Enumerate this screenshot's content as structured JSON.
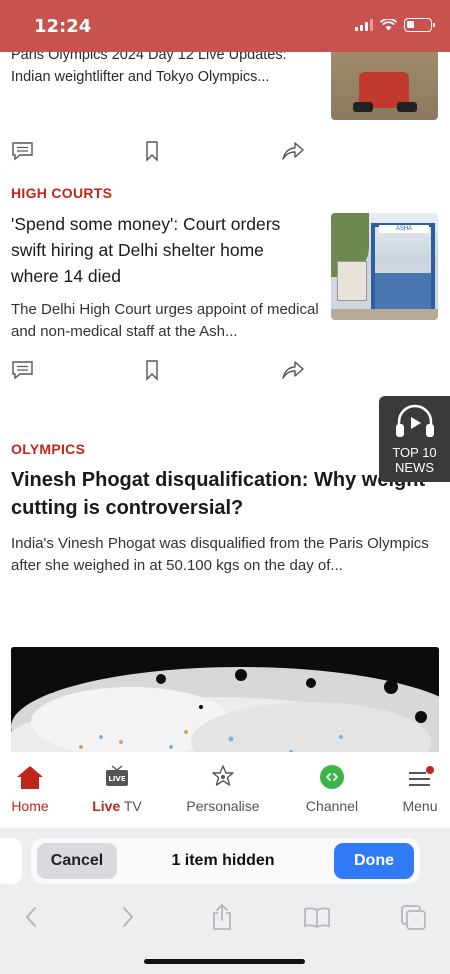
{
  "status": {
    "time": "12:24"
  },
  "articles": [
    {
      "category": "",
      "headline": "Paris Olympics 2024 Day 12 Live Updates: Indian weightlifter and Tokyo Olympics..."
    },
    {
      "category": "HIGH COURTS",
      "headline": "'Spend some money': Court orders swift hiring at Delhi shelter home where 14 died",
      "summary": "The Delhi High Court urges appoint of medical and non-medical staff at the Ash...",
      "thumb_sign": "ASHA"
    },
    {
      "category": "OLYMPICS",
      "headline": "Vinesh Phogat disqualification: Why weight cutting is controversial?",
      "summary": "India's Vinesh Phogat was disqualified from the Paris Olympics after she weighed in at 50.100 kgs on the day of..."
    }
  ],
  "top10": {
    "line1": "TOP 10",
    "line2": "NEWS"
  },
  "tabs": {
    "home": "Home",
    "live_badge": "LIVE",
    "live_red": "Live",
    "live_rest": " TV",
    "personalise": "Personalise",
    "channel": "Channel",
    "menu": "Menu"
  },
  "find": {
    "cancel": "Cancel",
    "status": "1 item hidden",
    "done": "Done"
  },
  "icons": [
    "comment-icon",
    "bookmark-icon",
    "share-icon",
    "headphones-play-icon",
    "home-icon",
    "live-tv-icon",
    "personalise-icon",
    "channel-icon",
    "menu-icon",
    "back-icon",
    "forward-icon",
    "share-sheet-icon",
    "bookmarks-icon",
    "tabs-icon"
  ],
  "colors": {
    "status_bar": "#c8524e",
    "accent": "#c0261c",
    "done_button": "#2f7cf6"
  }
}
